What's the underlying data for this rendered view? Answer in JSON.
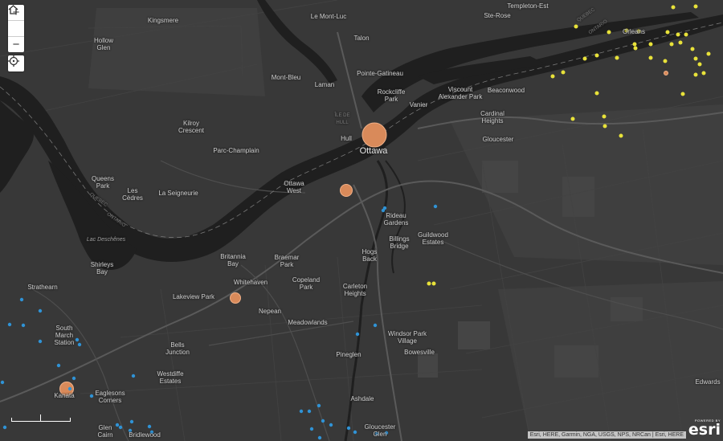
{
  "map": {
    "controls": {
      "zoom_in": "+",
      "zoom_out": "−"
    },
    "attribution": "Esri, HERE, Garmin, NGA, USGS, NPS, NRCan | Esri, HERE",
    "logo": {
      "powered": "POWERED BY",
      "word": "esri"
    },
    "labels": [
      {
        "name": "templeton-est",
        "text": "Templeton-Est"
      },
      {
        "name": "ste-rose",
        "text": "Ste-Rose"
      },
      {
        "name": "le-mont-luc",
        "text": "Le Mont-Luc"
      },
      {
        "name": "kingsmere",
        "text": "Kingsmere"
      },
      {
        "name": "hollow-glen",
        "text": "Hollow\nGlen"
      },
      {
        "name": "talon",
        "text": "Talon"
      },
      {
        "name": "orleans",
        "text": "Orleans"
      },
      {
        "name": "quebec-ne",
        "text": "QUEBEC"
      },
      {
        "name": "ontario-ne",
        "text": "ONTARIO"
      },
      {
        "name": "mont-bleu",
        "text": "Mont-Bleu"
      },
      {
        "name": "pointe-gatineau",
        "text": "Pointe-Gatineau"
      },
      {
        "name": "laman",
        "text": "Laman"
      },
      {
        "name": "rockcliffe-park",
        "text": "Rockcliffe\nPark"
      },
      {
        "name": "viscount-alexander-park",
        "text": "Viscount\nAlexander Park"
      },
      {
        "name": "beaconwood",
        "text": "Beaconwood"
      },
      {
        "name": "vanier",
        "text": "Vanier"
      },
      {
        "name": "ile-de-hull",
        "text": "ÎLE DE\nHULL"
      },
      {
        "name": "cardinal-heights",
        "text": "Cardinal\nHeights"
      },
      {
        "name": "kilroy-crescent",
        "text": "Kilroy\nCrescent"
      },
      {
        "name": "hull",
        "text": "Hull"
      },
      {
        "name": "ottawa",
        "text": "Ottawa"
      },
      {
        "name": "gloucester",
        "text": "Gloucester"
      },
      {
        "name": "parc-champlain",
        "text": "Parc-Champlain"
      },
      {
        "name": "queens-park",
        "text": "Queens\nPark"
      },
      {
        "name": "les-cedres",
        "text": "Les\nCèdres"
      },
      {
        "name": "la-seigneurie",
        "text": "La Seigneurie"
      },
      {
        "name": "ottawa-west",
        "text": "Ottawa\nWest"
      },
      {
        "name": "quebec-w",
        "text": "QUEBEC"
      },
      {
        "name": "ontario-w",
        "text": "ONTARIO"
      },
      {
        "name": "rideau-gardens",
        "text": "Rideau\nGardens"
      },
      {
        "name": "lac-deschenes",
        "text": "Lac Deschênes"
      },
      {
        "name": "guildwood-estates",
        "text": "Guildwood\nEstates"
      },
      {
        "name": "billings-bridge",
        "text": "Billings\nBridge"
      },
      {
        "name": "hogs-back",
        "text": "Hogs\nBack"
      },
      {
        "name": "britannia-bay",
        "text": "Britannia\nBay"
      },
      {
        "name": "braemar-park",
        "text": "Braemar\nPark"
      },
      {
        "name": "shirleys-bay",
        "text": "Shirleys\nBay"
      },
      {
        "name": "copeland-park",
        "text": "Copeland\nPark"
      },
      {
        "name": "whitehaven",
        "text": "Whitehaven"
      },
      {
        "name": "carleton-heights",
        "text": "Carleton\nHeights"
      },
      {
        "name": "strathearn",
        "text": "Strathearn"
      },
      {
        "name": "lakeview-park",
        "text": "Lakeview Park"
      },
      {
        "name": "nepean",
        "text": "Nepean"
      },
      {
        "name": "meadowlands",
        "text": "Meadowlands"
      },
      {
        "name": "south-march-station",
        "text": "South\nMarch\nStation"
      },
      {
        "name": "windsor-park-village",
        "text": "Windsor Park\nVillage"
      },
      {
        "name": "bells-junction",
        "text": "Bells\nJunction"
      },
      {
        "name": "bowesville",
        "text": "Bowesville"
      },
      {
        "name": "pineglen",
        "text": "Pineglen"
      },
      {
        "name": "westdiffe-estates",
        "text": "Westdiffe\nEstates"
      },
      {
        "name": "edwards",
        "text": "Edwards"
      },
      {
        "name": "kanata",
        "text": "Kanata"
      },
      {
        "name": "eaglesons-corners",
        "text": "Eaglesons\nCorners"
      },
      {
        "name": "ashdale",
        "text": "Ashdale"
      },
      {
        "name": "glen-cairn",
        "text": "Glen\nCairn"
      },
      {
        "name": "bridlewood",
        "text": "Bridlewood"
      },
      {
        "name": "gloucester-glen",
        "text": "Gloucester\nGlen"
      }
    ],
    "symbol_colors": {
      "large": "#d98a5a",
      "yellow": "#e8e23a",
      "blue": "#2f93d6"
    }
  }
}
